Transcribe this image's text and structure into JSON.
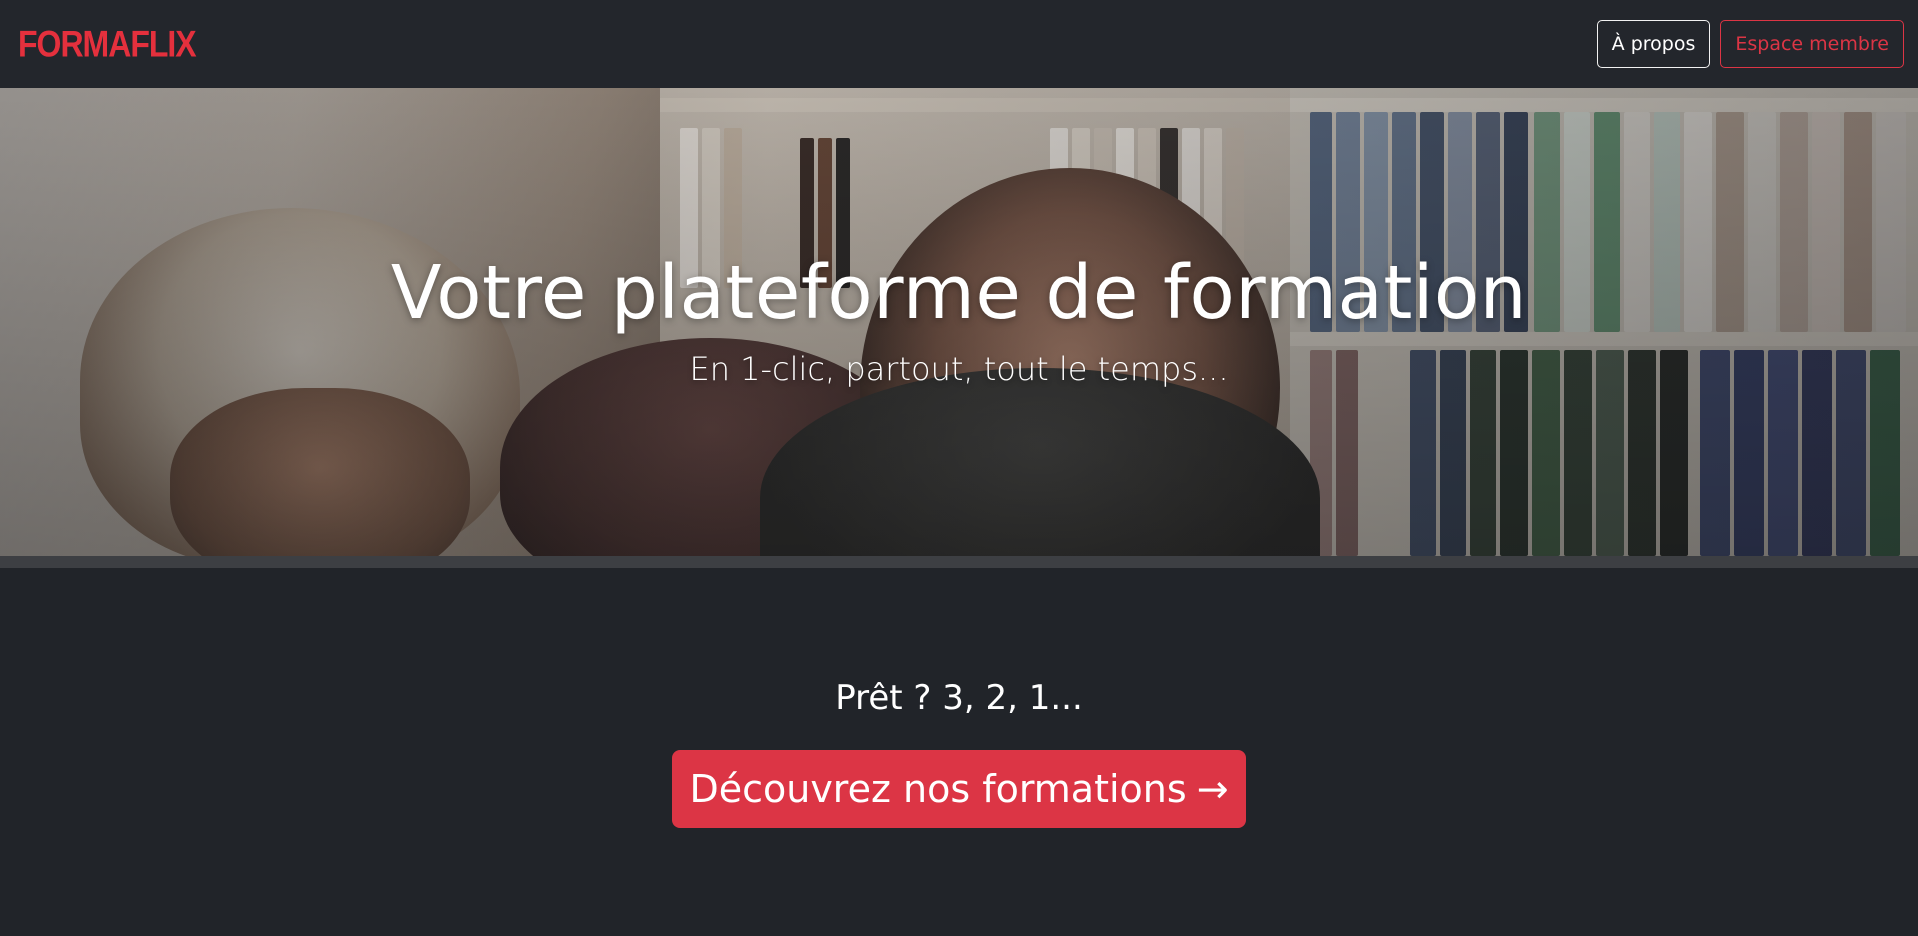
{
  "navbar": {
    "brand": "FORMAFLIX",
    "about_label": "À propos",
    "member_label": "Espace membre"
  },
  "hero": {
    "title": "Votre plateforme de formation",
    "subtitle": "En 1-clic, partout, tout le temps..."
  },
  "cta": {
    "kicker": "Prêt ? 3, 2, 1...",
    "button_label": "Découvrez nos formations",
    "button_arrow": "→"
  },
  "colors": {
    "brand": "#e4303d",
    "danger": "#dc3545",
    "background": "#212429",
    "navbar": "#23262c"
  }
}
